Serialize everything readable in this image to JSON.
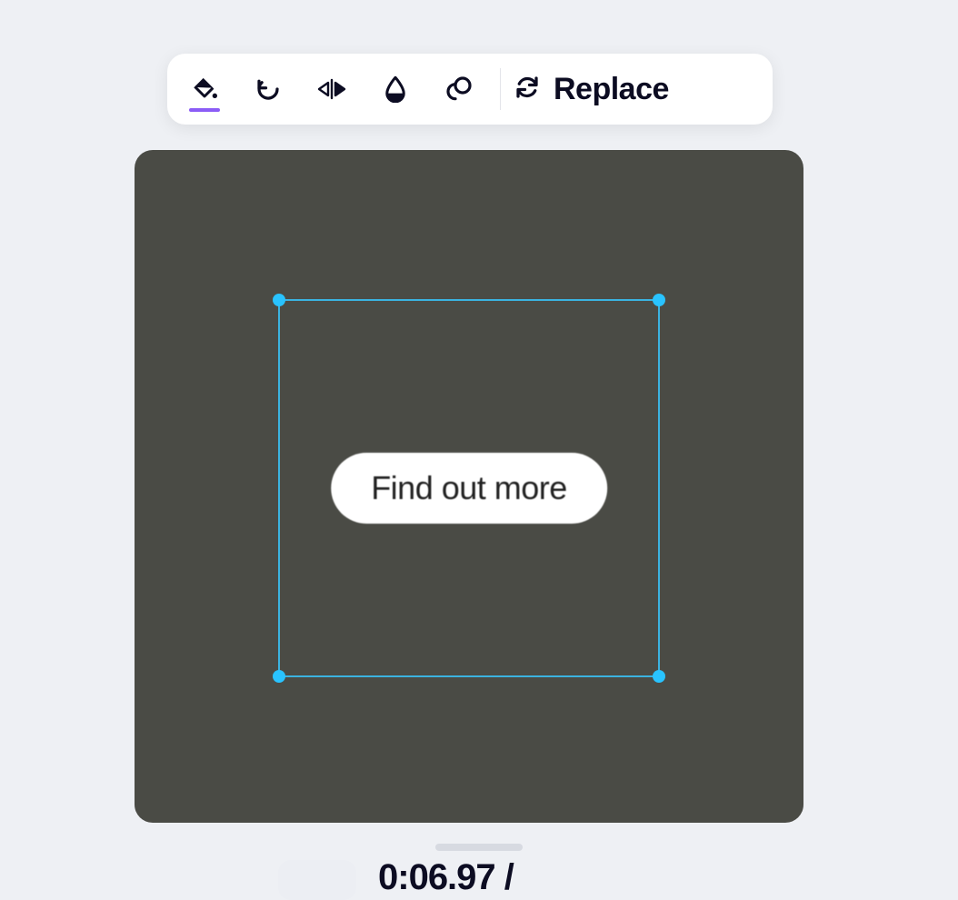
{
  "toolbar": {
    "replace_label": "Replace",
    "buttons": {
      "fill": "fill-icon",
      "rotate": "rotate-ccw-icon",
      "flip": "flip-horizontal-icon",
      "opacity": "opacity-icon",
      "layers": "layers-icon",
      "sync": "sync-icon"
    }
  },
  "canvas": {
    "cta_label": "Find out more"
  },
  "footer": {
    "time_fragment": "0:06.97 /"
  },
  "colors": {
    "accent": "#8b5cf6",
    "selection": "#29c3ff",
    "canvas_bg": "#4a4b45"
  }
}
